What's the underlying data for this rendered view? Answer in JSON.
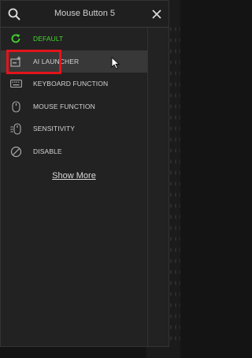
{
  "header": {
    "title": "Mouse Button 5",
    "search_icon": "search-icon",
    "close_icon": "close-icon"
  },
  "items": [
    {
      "label": "DEFAULT",
      "icon": "refresh-icon",
      "color": "#44d62c"
    },
    {
      "label": "AI LAUNCHER",
      "icon": "ai-launcher-icon",
      "state": "hovered"
    },
    {
      "label": "KEYBOARD FUNCTION",
      "icon": "keyboard-icon"
    },
    {
      "label": "MOUSE FUNCTION",
      "icon": "mouse-icon"
    },
    {
      "label": "SENSITIVITY",
      "icon": "sensitivity-icon"
    },
    {
      "label": "DISABLE",
      "icon": "disable-icon"
    }
  ],
  "show_more": "Show More",
  "colors": {
    "accent": "#44d62c",
    "highlight": "#e3141b",
    "panel": "#222222",
    "hover": "#383838"
  }
}
